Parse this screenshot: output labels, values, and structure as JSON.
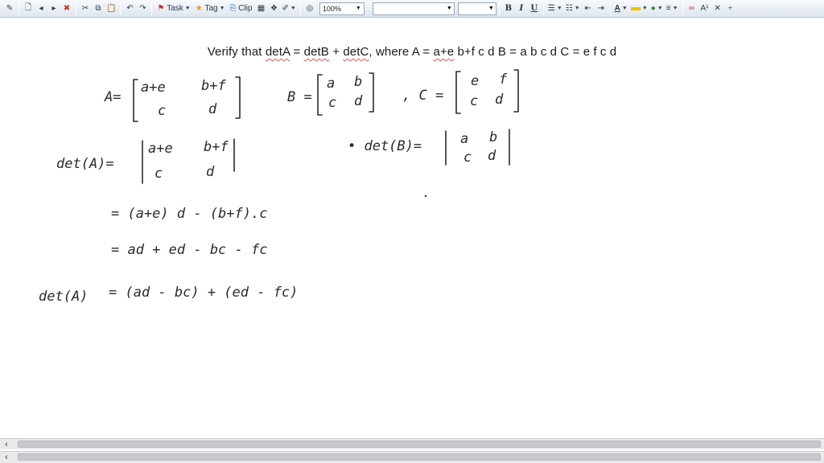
{
  "toolbar": {
    "task_label": "Task",
    "tag_label": "Tag",
    "clip_label": "Clip",
    "zoom_value": "100%",
    "bold": "B",
    "italic": "I",
    "underline": "U",
    "font_color_letter": "A",
    "text_size_label": "A¹"
  },
  "page": {
    "title": {
      "prefix": "Verify that ",
      "w1": "detA",
      "mid1": " = ",
      "w2": "detB",
      "mid2": " + ",
      "w3": "detC",
      "mid3": ", where A = ",
      "w4": "a+e",
      "rest": " b+f c d B = a b c d C = e f c d"
    },
    "handwriting": {
      "a_label": "A=",
      "a_r1c1": "a+e",
      "a_r1c2": "b+f",
      "a_r2c1": "c",
      "a_r2c2": "d",
      "b_label": "B =",
      "b_r1c1": "a",
      "b_r1c2": "b",
      "b_r2c1": "c",
      "b_r2c2": "d",
      "c_label": ", C =",
      "c_r1c1": "e",
      "c_r1c2": "f",
      "c_r2c1": "c",
      "c_r2c2": "d",
      "deta_label": "det(A)=",
      "deta_r1c1": "a+e",
      "deta_r1c2": "b+f",
      "deta_r2c1": "c",
      "deta_r2c2": "d",
      "detb_label": "• det(B)=",
      "detb_r1c1": "a",
      "detb_r1c2": "b",
      "detb_r2c1": "c",
      "detb_r2c2": "d",
      "line1": "= (a+e) d - (b+f).c",
      "line2": "= ad + ed - bc - fc",
      "line3_label": "det(A)",
      "line3_expr": "= (ad - bc) + (ed - fc)"
    }
  }
}
